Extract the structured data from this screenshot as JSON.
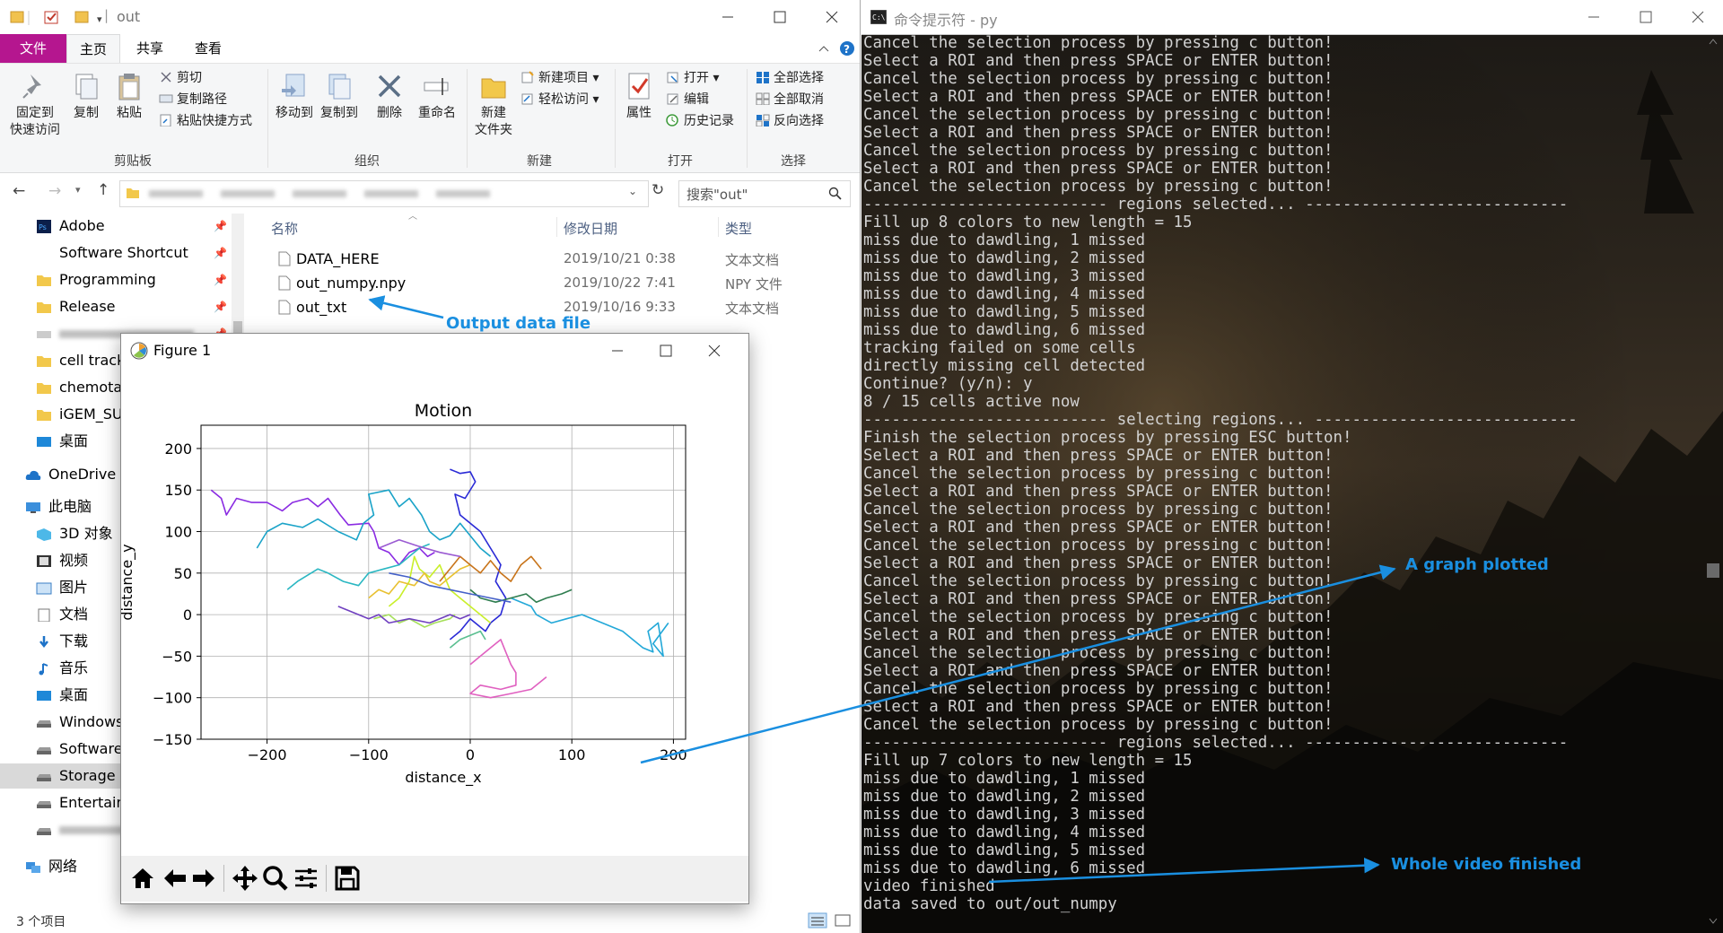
{
  "explorer": {
    "title": "out",
    "tabs": [
      "文件",
      "主页",
      "共享",
      "查看"
    ],
    "ribbon": {
      "clipboard": {
        "group_label": "剪贴板",
        "pin_label_1": "固定到",
        "pin_label_2": "快速访问",
        "copy": "复制",
        "paste": "粘贴",
        "cut": "剪切",
        "copy_path": "复制路径",
        "paste_shortcut": "粘贴快捷方式"
      },
      "organize": {
        "group_label": "组织",
        "move_to": "移动到",
        "copy_to": "复制到",
        "delete": "删除",
        "rename": "重命名"
      },
      "new": {
        "group_label": "新建",
        "new_folder_1": "新建",
        "new_folder_2": "文件夹",
        "new_item": "新建项目 ▾",
        "easy_access": "轻松访问 ▾"
      },
      "open": {
        "group_label": "打开",
        "properties": "属性",
        "open": "打开 ▾",
        "edit": "编辑",
        "history": "历史记录"
      },
      "select": {
        "group_label": "选择",
        "select_all": "全部选择",
        "select_none": "全部取消",
        "invert": "反向选择"
      }
    },
    "search_placeholder": "搜索\"out\"",
    "nav": [
      {
        "label": "Adobe",
        "icon": "adobe-icon",
        "pinned": true
      },
      {
        "label": "Software Shortcut",
        "icon": "",
        "pinned": true
      },
      {
        "label": "Programming",
        "icon": "folder-icon",
        "pinned": true
      },
      {
        "label": "Release",
        "icon": "folder-icon",
        "pinned": true
      },
      {
        "label": "",
        "icon": "blurred-icon",
        "pinned": true
      },
      {
        "label": "cell track",
        "icon": "folder-icon",
        "pinned": false
      },
      {
        "label": "chemotax",
        "icon": "folder-icon",
        "pinned": false
      },
      {
        "label": "iGEM_SUS",
        "icon": "folder-icon",
        "pinned": false
      },
      {
        "label": "桌面",
        "icon": "desktop-icon",
        "pinned": false
      },
      {
        "label": "OneDrive",
        "icon": "cloud-icon",
        "pinned": false
      },
      {
        "label": "此电脑",
        "icon": "pc-icon",
        "pinned": false
      },
      {
        "label": "3D 对象",
        "icon": "cube-icon",
        "pinned": false
      },
      {
        "label": "视频",
        "icon": "video-icon",
        "pinned": false
      },
      {
        "label": "图片",
        "icon": "picture-icon",
        "pinned": false
      },
      {
        "label": "文档",
        "icon": "document-icon",
        "pinned": false
      },
      {
        "label": "下载",
        "icon": "download-icon",
        "pinned": false
      },
      {
        "label": "音乐",
        "icon": "music-icon",
        "pinned": false
      },
      {
        "label": "桌面",
        "icon": "desktop-icon",
        "pinned": false
      },
      {
        "label": "Windows",
        "icon": "drive-icon",
        "pinned": false
      },
      {
        "label": "Software",
        "icon": "drive-icon",
        "pinned": false
      },
      {
        "label": "Storage C",
        "icon": "drive-icon",
        "pinned": false
      },
      {
        "label": "Entertain",
        "icon": "drive-icon",
        "pinned": false
      },
      {
        "label": "",
        "icon": "drive-icon",
        "pinned": false
      },
      {
        "label": "网络",
        "icon": "network-icon",
        "pinned": false
      }
    ],
    "columns": {
      "name": "名称",
      "date": "修改日期",
      "type": "类型"
    },
    "files": [
      {
        "name": "DATA_HERE",
        "date": "2019/10/21 0:38",
        "type": "文本文档"
      },
      {
        "name": "out_numpy.npy",
        "date": "2019/10/22 7:41",
        "type": "NPY 文件"
      },
      {
        "name": "out_txt",
        "date": "2019/10/16 9:33",
        "type": "文本文档"
      }
    ],
    "status": "3 个项目"
  },
  "figure": {
    "title": "Figure 1",
    "toolbar": [
      "home-icon",
      "back-icon",
      "forward-icon",
      "pan-icon",
      "zoom-icon",
      "configure-icon",
      "save-icon"
    ]
  },
  "chart_data": {
    "type": "line",
    "title": "Motion",
    "xlabel": "distance_x",
    "ylabel": "distance_y",
    "xlim": [
      -265,
      212
    ],
    "ylim": [
      -150,
      228
    ],
    "xticks": [
      -200,
      -100,
      0,
      100,
      200
    ],
    "yticks": [
      -150,
      -100,
      -50,
      0,
      50,
      100,
      150,
      200
    ],
    "xtick_labels": [
      "−200",
      "−100",
      "0",
      "100",
      "200"
    ],
    "ytick_labels": [
      "−150",
      "−100",
      "−50",
      "0",
      "50",
      "100",
      "150",
      "200"
    ],
    "grid": true,
    "series": [
      {
        "color": "#8a2be2",
        "x": [
          -255,
          -245,
          -240,
          -230,
          -215,
          -200,
          -185,
          -175,
          -160,
          -150,
          -140,
          -128,
          -120,
          -100,
          -95,
          -90,
          -80,
          -70,
          -60,
          -50,
          -42,
          -35
        ],
        "y": [
          150,
          140,
          120,
          140,
          135,
          135,
          125,
          135,
          140,
          130,
          140,
          120,
          108,
          110,
          100,
          80,
          75,
          60,
          75,
          80,
          70,
          75
        ]
      },
      {
        "color": "#2a2ad6",
        "x": [
          -20,
          -10,
          0,
          5,
          -5,
          -15,
          -10,
          0,
          10,
          20,
          30,
          25,
          35,
          30,
          20,
          15,
          10,
          0,
          -10,
          -20
        ],
        "y": [
          175,
          170,
          172,
          160,
          140,
          145,
          120,
          110,
          100,
          80,
          60,
          40,
          20,
          0,
          -10,
          -20,
          -15,
          -5,
          -20,
          -30
        ]
      },
      {
        "color": "#1aa3c8",
        "x": [
          -210,
          -200,
          -185,
          -165,
          -150,
          -130,
          -112,
          -105,
          -95,
          -100,
          -80,
          -70,
          -60,
          -48,
          -40,
          -30,
          -20,
          -10,
          0,
          10,
          20
        ],
        "y": [
          80,
          100,
          110,
          105,
          115,
          100,
          90,
          110,
          120,
          145,
          150,
          130,
          140,
          120,
          100,
          90,
          95,
          110,
          95,
          80,
          70
        ]
      },
      {
        "color": "#22a8d8",
        "x": [
          40,
          60,
          65,
          80,
          95,
          110,
          130,
          150,
          160,
          170,
          180,
          175,
          185,
          190,
          180,
          195
        ],
        "y": [
          20,
          10,
          0,
          -10,
          -5,
          0,
          -10,
          -20,
          -30,
          -40,
          -45,
          -20,
          -10,
          -50,
          -35,
          -10
        ]
      },
      {
        "color": "#2ab7c2",
        "x": [
          -180,
          -170,
          -150,
          -140,
          -125,
          -110,
          -100,
          -85,
          -70,
          -60,
          -50,
          -40
        ],
        "y": [
          30,
          40,
          55,
          50,
          40,
          35,
          50,
          55,
          60,
          70,
          80,
          85
        ]
      },
      {
        "color": "#c9ef2a",
        "x": [
          -80,
          -70,
          -60,
          -55,
          -50,
          -40,
          -30,
          -20,
          -10,
          0,
          10,
          20
        ],
        "y": [
          10,
          20,
          40,
          70,
          55,
          45,
          60,
          30,
          20,
          10,
          0,
          -10
        ]
      },
      {
        "color": "#a6e05b",
        "x": [
          -95,
          -80,
          -70,
          -60,
          -45,
          -35,
          -20,
          -15
        ],
        "y": [
          -5,
          0,
          -10,
          -5,
          -15,
          -10,
          -5,
          0
        ]
      },
      {
        "color": "#e8c030",
        "x": [
          -100,
          -90,
          -80,
          -70,
          -55,
          -45,
          -40,
          -30,
          -20,
          -10,
          0
        ],
        "y": [
          20,
          30,
          25,
          40,
          35,
          50,
          40,
          35,
          45,
          55,
          60
        ]
      },
      {
        "color": "#c8741a",
        "x": [
          -30,
          -20,
          -10,
          0,
          10,
          20,
          30,
          40,
          50,
          60,
          70
        ],
        "y": [
          40,
          55,
          70,
          60,
          50,
          65,
          50,
          40,
          60,
          70,
          55
        ]
      },
      {
        "color": "#2e7d4f",
        "x": [
          0,
          10,
          25,
          40,
          55,
          65,
          75,
          90,
          100
        ],
        "y": [
          30,
          20,
          15,
          20,
          25,
          15,
          20,
          25,
          30
        ]
      },
      {
        "color": "#7040c0",
        "x": [
          -130,
          -120,
          -110,
          -100,
          -90,
          -80,
          -60,
          -40,
          -20,
          -10,
          0
        ],
        "y": [
          10,
          5,
          0,
          -5,
          0,
          -10,
          -5,
          -10,
          0,
          -5,
          0
        ]
      },
      {
        "color": "#e060c0",
        "x": [
          0,
          10,
          20,
          30,
          35,
          40,
          45,
          45,
          30,
          10,
          0,
          20,
          40,
          60,
          75
        ],
        "y": [
          -60,
          -50,
          -40,
          -30,
          -45,
          -60,
          -70,
          -85,
          -90,
          -85,
          -95,
          -100,
          -95,
          -90,
          -75
        ]
      },
      {
        "color": "#4460c8",
        "x": [
          -80,
          -60,
          -40,
          -20,
          0,
          20,
          40
        ],
        "y": [
          50,
          45,
          35,
          30,
          25,
          20,
          15
        ]
      },
      {
        "color": "#5abf90",
        "x": [
          -20,
          -10,
          0,
          10,
          15
        ],
        "y": [
          -40,
          -30,
          -25,
          -20,
          -30
        ]
      },
      {
        "color": "#9a5ad2",
        "x": [
          -90,
          -70,
          -50,
          -30,
          -10
        ],
        "y": [
          80,
          90,
          82,
          75,
          70
        ]
      }
    ]
  },
  "terminal": {
    "title": "命令提示符 - py",
    "lines": [
      "Cancel the selection process by pressing c button!",
      "Select a ROI and then press SPACE or ENTER button!",
      "Cancel the selection process by pressing c button!",
      "Select a ROI and then press SPACE or ENTER button!",
      "Cancel the selection process by pressing c button!",
      "Select a ROI and then press SPACE or ENTER button!",
      "Cancel the selection process by pressing c button!",
      "Select a ROI and then press SPACE or ENTER button!",
      "Cancel the selection process by pressing c button!",
      "-------------------------- regions selected... ----------------------------",
      "Fill up 8 colors to new length = 15",
      "miss due to dawdling, 1 missed",
      "miss due to dawdling, 2 missed",
      "miss due to dawdling, 3 missed",
      "miss due to dawdling, 4 missed",
      "miss due to dawdling, 5 missed",
      "miss due to dawdling, 6 missed",
      "tracking failed on some cells",
      "directly missing cell detected",
      "Continue? (y/n): y",
      "8 / 15 cells active now",
      "-------------------------- selecting regions... ----------------------------",
      "Finish the selection process by pressing ESC button!",
      "Select a ROI and then press SPACE or ENTER button!",
      "Cancel the selection process by pressing c button!",
      "Select a ROI and then press SPACE or ENTER button!",
      "Cancel the selection process by pressing c button!",
      "Select a ROI and then press SPACE or ENTER button!",
      "Cancel the selection process by pressing c button!",
      "Select a ROI and then press SPACE or ENTER button!",
      "Cancel the selection process by pressing c button!",
      "Select a ROI and then press SPACE or ENTER button!",
      "Cancel the selection process by pressing c button!",
      "Select a ROI and then press SPACE or ENTER button!",
      "Cancel the selection process by pressing c button!",
      "Select a ROI and then press SPACE or ENTER button!",
      "Cancel the selection process by pressing c button!",
      "Select a ROI and then press SPACE or ENTER button!",
      "Cancel the selection process by pressing c button!",
      "-------------------------- regions selected... ----------------------------",
      "Fill up 7 colors to new length = 15",
      "miss due to dawdling, 1 missed",
      "miss due to dawdling, 2 missed",
      "miss due to dawdling, 3 missed",
      "miss due to dawdling, 4 missed",
      "miss due to dawdling, 5 missed",
      "miss due to dawdling, 6 missed",
      "video finished",
      "data saved to out/out_numpy"
    ]
  },
  "annotations": {
    "output_file": "Output data file",
    "graph": "A graph plotted",
    "video": "Whole video finished",
    "color": "#1a8fe0"
  }
}
